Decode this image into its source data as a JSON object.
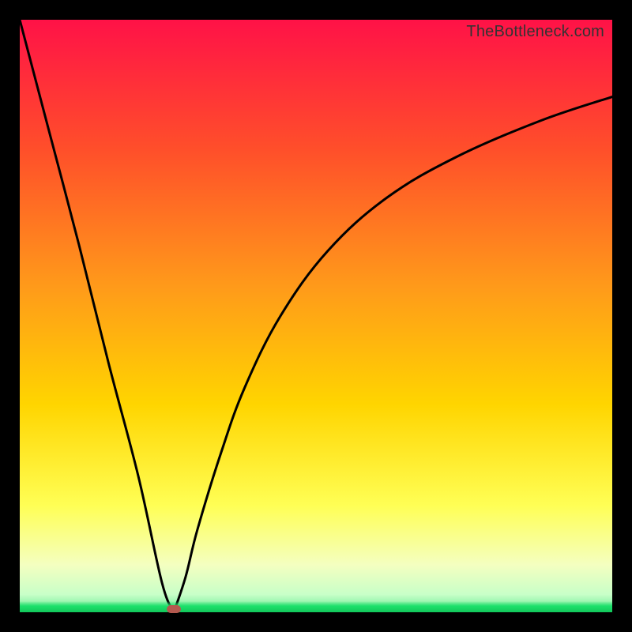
{
  "watermark": "TheBottleneck.com",
  "colors": {
    "frame": "#000000",
    "curve": "#000000",
    "marker": "#b4594f",
    "gradient_top": "#ff1247",
    "gradient_mid1": "#ff7a1a",
    "gradient_mid2": "#ffd500",
    "gradient_mid3": "#ffff66",
    "gradient_bottom": "#b6ffb6",
    "green_edge": "#18cf60"
  },
  "chart_data": {
    "type": "line",
    "title": "",
    "xlabel": "",
    "ylabel": "",
    "xlim": [
      0,
      100
    ],
    "ylim": [
      0,
      100
    ],
    "annotations": [],
    "series": [
      {
        "name": "left-branch",
        "x": [
          0,
          5,
          10,
          15,
          20,
          24,
          26
        ],
        "values": [
          100,
          81,
          62,
          42,
          23,
          5,
          0
        ]
      },
      {
        "name": "right-branch",
        "x": [
          26,
          28,
          30,
          34,
          38,
          44,
          52,
          62,
          74,
          88,
          100
        ],
        "values": [
          0,
          6,
          14,
          27,
          38,
          50,
          61,
          70,
          77,
          83,
          87
        ]
      }
    ],
    "marker": {
      "x": 26,
      "y": 0
    }
  }
}
